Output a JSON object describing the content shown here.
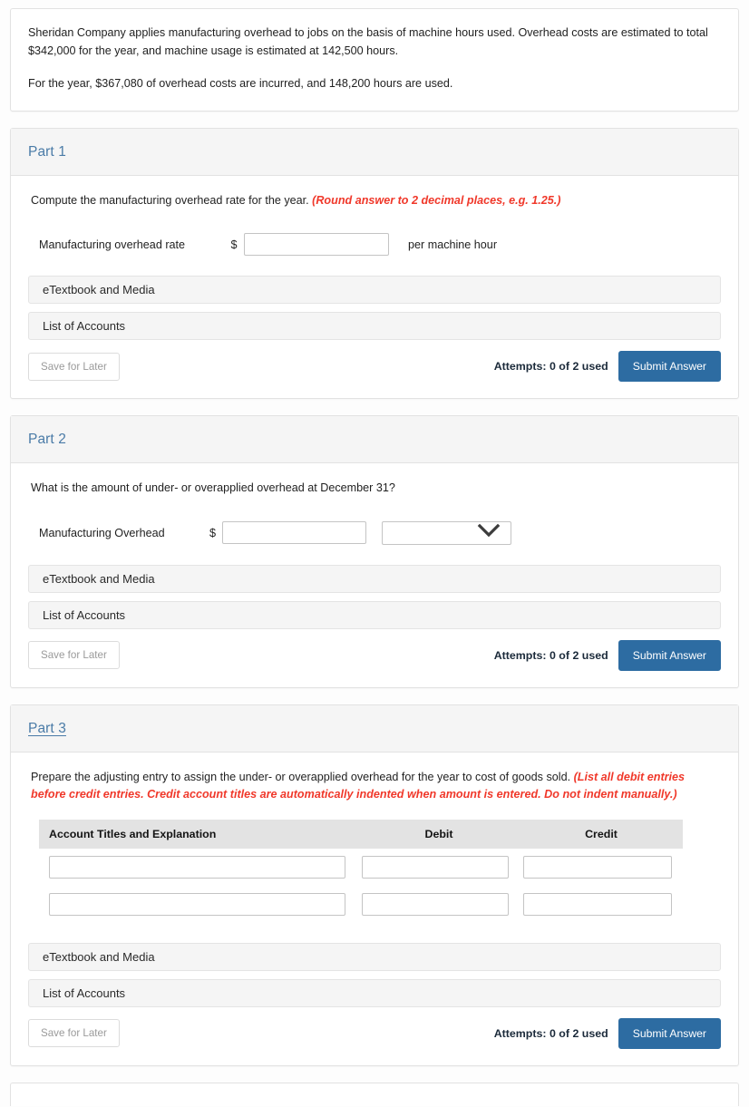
{
  "problem": {
    "paragraph1": "Sheridan Company applies manufacturing overhead to jobs on the basis of machine hours used. Overhead costs are estimated to total $342,000 for the year, and machine usage is estimated at 142,500 hours.",
    "paragraph2": "For the year, $367,080 of overhead costs are incurred, and 148,200 hours are used."
  },
  "common": {
    "etextbook_label": "eTextbook and Media",
    "list_of_accounts_label": "List of Accounts",
    "save_for_later_label": "Save for Later",
    "attempts_label": "Attempts: 0 of 2 used",
    "submit_label": "Submit Answer",
    "dollar_sign": "$",
    "accent_blue": "#2d6ca2",
    "part_title_color": "#4a7ba7",
    "hint_red": "#f0382a"
  },
  "part1": {
    "title": "Part 1",
    "question": "Compute the manufacturing overhead rate for the year.",
    "hint": "(Round answer to 2 decimal places, e.g. 1.25.)",
    "field_label": "Manufacturing overhead rate",
    "field_value": "",
    "suffix": "per machine hour"
  },
  "part2": {
    "title": "Part 2",
    "question": "What is the amount of under- or overapplied overhead at December 31?",
    "field_label": "Manufacturing Overhead",
    "field_value": "",
    "select_value": ""
  },
  "part3": {
    "title": "Part 3",
    "question": "Prepare the adjusting entry to assign the under- or overapplied overhead for the year to cost of goods sold.",
    "hint": "(List all debit entries before credit entries. Credit account titles are automatically indented when amount is entered. Do not indent manually.)",
    "table": {
      "headers": [
        "Account Titles and Explanation",
        "Debit",
        "Credit"
      ],
      "rows": [
        {
          "account": "",
          "debit": "",
          "credit": ""
        },
        {
          "account": "",
          "debit": "",
          "credit": ""
        }
      ]
    }
  }
}
